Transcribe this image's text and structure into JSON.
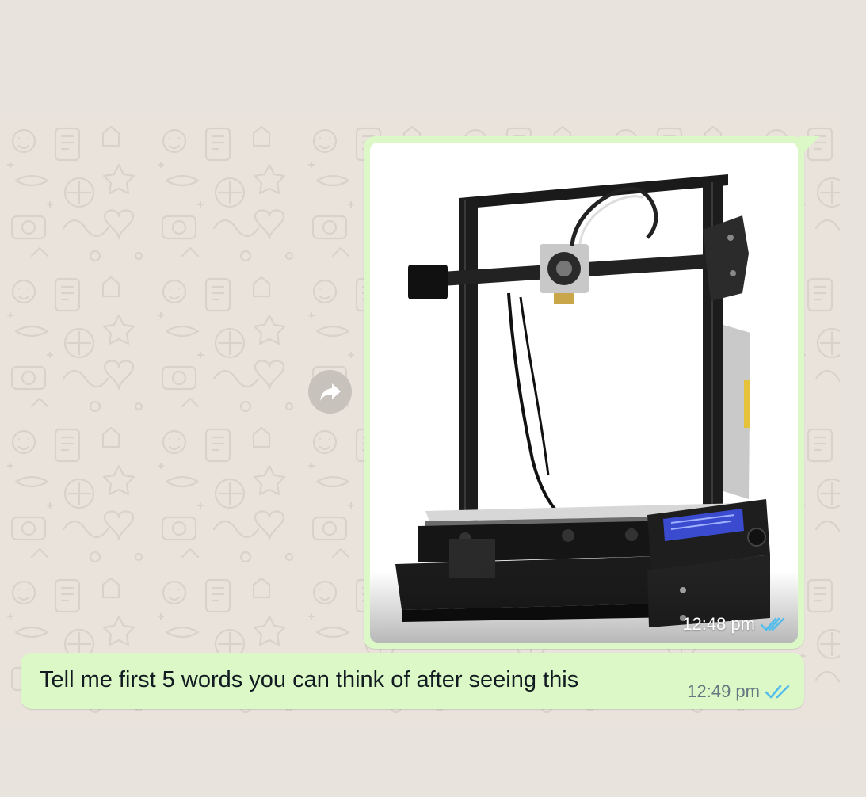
{
  "chat": {
    "image_message": {
      "time": "12:48 pm",
      "read_status_icon": "double-check-icon",
      "read_status_color": "#53bdeb"
    },
    "text_message": {
      "text": "Tell me first 5 words you can think of after seeing this",
      "time": "12:49 pm",
      "read_status_icon": "double-check-icon",
      "read_status_color": "#53bdeb"
    },
    "forward_button_icon": "forward-arrow-icon"
  },
  "theme": {
    "outgoing_bubble": "#dbf8c6",
    "wallpaper": "#e9e3dc",
    "page_background": "#e8e3dd"
  }
}
